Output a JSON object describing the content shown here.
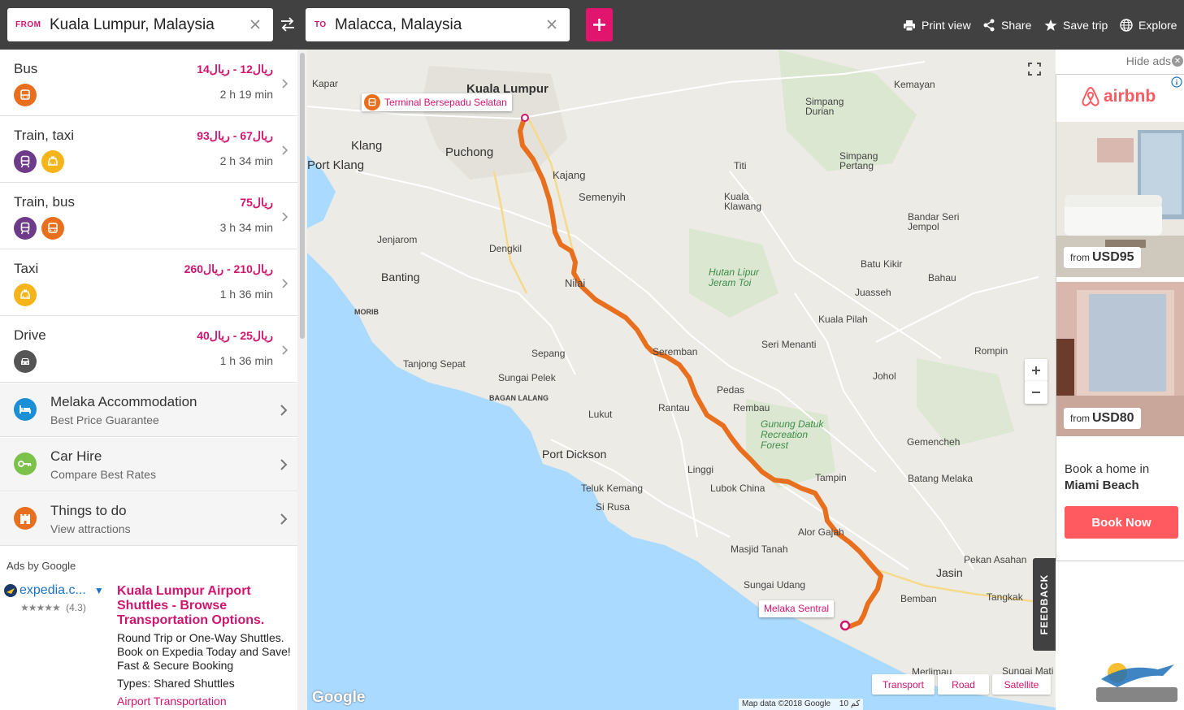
{
  "header": {
    "from_label": "FROM",
    "from_value": "Kuala Lumpur, Malaysia",
    "to_label": "TO",
    "to_value": "Malacca, Malaysia",
    "actions": [
      {
        "label": "Print view",
        "icon": "printer-icon"
      },
      {
        "label": "Share",
        "icon": "share-icon"
      },
      {
        "label": "Save trip",
        "icon": "star-icon"
      },
      {
        "label": "Explore",
        "icon": "globe-icon"
      }
    ]
  },
  "routes": [
    {
      "mode": "Bus",
      "price": "ريال12 - ريال14",
      "duration": "2 h 19 min",
      "icons": [
        "bus-icon"
      ]
    },
    {
      "mode": "Train, taxi",
      "price": "ريال67 - ريال93",
      "duration": "2 h 34 min",
      "icons": [
        "train-icon",
        "taxi-icon"
      ]
    },
    {
      "mode": "Train, bus",
      "price": "ريال75",
      "duration": "3 h 34 min",
      "icons": [
        "train-icon",
        "bus-icon"
      ]
    },
    {
      "mode": "Taxi",
      "price": "ريال210 - ريال260",
      "duration": "1 h 36 min",
      "icons": [
        "taxi-icon"
      ]
    },
    {
      "mode": "Drive",
      "price": "ريال25 - ريال40",
      "duration": "1 h 36 min",
      "icons": [
        "car-icon"
      ]
    }
  ],
  "extras": [
    {
      "title": "Melaka Accommodation",
      "subtitle": "Best Price Guarantee",
      "icon": "bed-icon",
      "color": "#1a8fd6"
    },
    {
      "title": "Car Hire",
      "subtitle": "Compare Best Rates",
      "icon": "key-icon",
      "color": "#7cc24a"
    },
    {
      "title": "Things to do",
      "subtitle": "View attractions",
      "icon": "castle-icon",
      "color": "#e86f1e"
    }
  ],
  "google_ad": {
    "label": "Ads by Google",
    "source": "expedia.c...",
    "rating": "(4.3)",
    "title": "Kuala Lumpur Airport Shuttles - Browse Transportation Options.",
    "body": "Round Trip or One-Way Shuttles. Book on Expedia Today and Save! Fast & Secure Booking",
    "types": "Types: Shared Shuttles",
    "link": "Airport Transportation"
  },
  "map": {
    "origin_callout": "Terminal Bersepadu Selatan",
    "dest_callout": "Melaka Sentral",
    "labels": [
      {
        "text": "Kuala Lumpur",
        "kind": "city"
      },
      {
        "text": "Klang",
        "kind": "city"
      },
      {
        "text": "Puchong",
        "kind": "city"
      },
      {
        "text": "Port Klang",
        "kind": "city"
      },
      {
        "text": "Kajang",
        "kind": "city"
      },
      {
        "text": "Semenyih",
        "kind": "town"
      },
      {
        "text": "Jenjarom",
        "kind": "town"
      },
      {
        "text": "Dengkil",
        "kind": "town"
      },
      {
        "text": "Banting",
        "kind": "city"
      },
      {
        "text": "Nilai",
        "kind": "city"
      },
      {
        "text": "Seremban",
        "kind": "town"
      },
      {
        "text": "Sepang",
        "kind": "town"
      },
      {
        "text": "Tanjong Sepat",
        "kind": "town"
      },
      {
        "text": "Sungai Pelek",
        "kind": "town"
      },
      {
        "text": "Port Dickson",
        "kind": "city"
      },
      {
        "text": "Lukut",
        "kind": "town"
      },
      {
        "text": "Rantau",
        "kind": "town"
      },
      {
        "text": "Rembau",
        "kind": "town"
      },
      {
        "text": "Pedas",
        "kind": "town"
      },
      {
        "text": "Linggi",
        "kind": "town"
      },
      {
        "text": "Teluk Kemang",
        "kind": "town"
      },
      {
        "text": "Si Rusa",
        "kind": "town"
      },
      {
        "text": "Lubok China",
        "kind": "town"
      },
      {
        "text": "Tampin",
        "kind": "town"
      },
      {
        "text": "Alor Gajah",
        "kind": "town"
      },
      {
        "text": "Masjid Tanah",
        "kind": "town"
      },
      {
        "text": "Sungai Udang",
        "kind": "town"
      },
      {
        "text": "Jasin",
        "kind": "city"
      },
      {
        "text": "Bemban",
        "kind": "town"
      },
      {
        "text": "Kemayan",
        "kind": "town"
      },
      {
        "text": "Simpang Durian",
        "kind": "town"
      },
      {
        "text": "Simpang Pertang",
        "kind": "town"
      },
      {
        "text": "Titi",
        "kind": "town"
      },
      {
        "text": "Kuala Klawang",
        "kind": "town"
      },
      {
        "text": "Bandar Seri Jempol",
        "kind": "town"
      },
      {
        "text": "Batu Kikir",
        "kind": "town"
      },
      {
        "text": "Juasseh",
        "kind": "town"
      },
      {
        "text": "Bahau",
        "kind": "town"
      },
      {
        "text": "Kuala Pilah",
        "kind": "town"
      },
      {
        "text": "Seri Menanti",
        "kind": "town"
      },
      {
        "text": "Johol",
        "kind": "town"
      },
      {
        "text": "Rompin",
        "kind": "town"
      },
      {
        "text": "Gemencheh",
        "kind": "town"
      },
      {
        "text": "Batang Melaka",
        "kind": "town"
      },
      {
        "text": "Pekan Asahan",
        "kind": "town"
      },
      {
        "text": "Tangkak",
        "kind": "town"
      },
      {
        "text": "Merlimau",
        "kind": "town"
      },
      {
        "text": "Sungai Mati",
        "kind": "town"
      },
      {
        "text": "Hutan Lipur Jeram Toi",
        "kind": "park"
      },
      {
        "text": "Gunung Datuk Recreation Forest",
        "kind": "park"
      },
      {
        "text": "Kapar",
        "kind": "town"
      },
      {
        "text": "MORIB",
        "kind": "town"
      },
      {
        "text": "BAGAN LALANG",
        "kind": "town"
      }
    ],
    "map_types": [
      "Transport",
      "Road",
      "Satellite"
    ],
    "attribution": "Map data ©2018 Google",
    "scale": "10 كم",
    "google_logo": "Google",
    "feedback": "FEEDBACK"
  },
  "right_ad": {
    "hide_ads": "Hide ads",
    "brand": "airbnb",
    "listings": [
      {
        "from": "from",
        "price": "USD95"
      },
      {
        "from": "from",
        "price": "USD80"
      }
    ],
    "promo_line1": "Book a home in",
    "promo_line2": "Miami Beach",
    "cta": "Book Now"
  }
}
